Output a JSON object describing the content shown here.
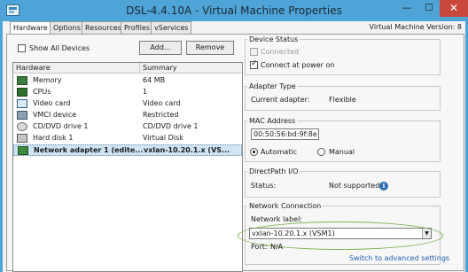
{
  "window": {
    "title": "DSL-4.4.10A - Virtual Machine Properties",
    "minimize_glyph": "—",
    "maximize_glyph": "☐",
    "close_glyph": "✕"
  },
  "tabs": [
    {
      "label": "Hardware"
    },
    {
      "label": "Options"
    },
    {
      "label": "Resources"
    },
    {
      "label": "Profiles"
    },
    {
      "label": "vServices"
    }
  ],
  "vm_version": "Virtual Machine Version: 8",
  "left": {
    "show_all_devices_label": "Show All Devices",
    "show_all_devices_checked": false,
    "add_button": "Add...",
    "remove_button": "Remove",
    "columns": {
      "hardware": "Hardware",
      "summary": "Summary"
    },
    "rows": [
      {
        "name": "Memory",
        "summary": "64 MB",
        "icon": "memory-icon"
      },
      {
        "name": "CPUs",
        "summary": "1",
        "icon": "cpu-icon"
      },
      {
        "name": "Video card",
        "summary": "Video card",
        "icon": "video-card-icon"
      },
      {
        "name": "VMCI device",
        "summary": "Restricted",
        "icon": "vmci-icon"
      },
      {
        "name": "CD/DVD drive 1",
        "summary": "CD/DVD drive 1",
        "icon": "cd-dvd-icon"
      },
      {
        "name": "Hard disk 1",
        "summary": "Virtual Disk",
        "icon": "hard-disk-icon"
      },
      {
        "name": "Network adapter 1 (edite...",
        "summary": "vxlan-10.20.1.x (VS...",
        "icon": "network-adapter-icon",
        "selected": true
      }
    ]
  },
  "device_status": {
    "title": "Device Status",
    "connected_label": "Connected",
    "connected_checked": false,
    "connect_power_on_label": "Connect at power on",
    "connect_power_on_checked": true
  },
  "adapter_type": {
    "title": "Adapter Type",
    "current_label": "Current adapter:",
    "current_value": "Flexible"
  },
  "mac_address": {
    "title": "MAC Address",
    "value": "00:50:56:bd:9f:8e",
    "automatic_label": "Automatic",
    "manual_label": "Manual",
    "selected": "Automatic"
  },
  "directpath": {
    "title": "DirectPath I/O",
    "status_label": "Status:",
    "status_value": "Not supported",
    "info_glyph": "i"
  },
  "network_connection": {
    "title": "Network Connection",
    "network_label": "Network label:",
    "selected_network": "vxlan-10.20.1.x (VSM1)",
    "port_label": "Port:",
    "port_value": "N/A",
    "advanced_link": "Switch to advanced settings"
  },
  "colors": {
    "titlebar": "#4ea4d6",
    "close_button": "#c9463d",
    "selection": "#cfe5f5",
    "highlight_ellipse": "#7fb24a",
    "link": "#1e5fb3"
  }
}
